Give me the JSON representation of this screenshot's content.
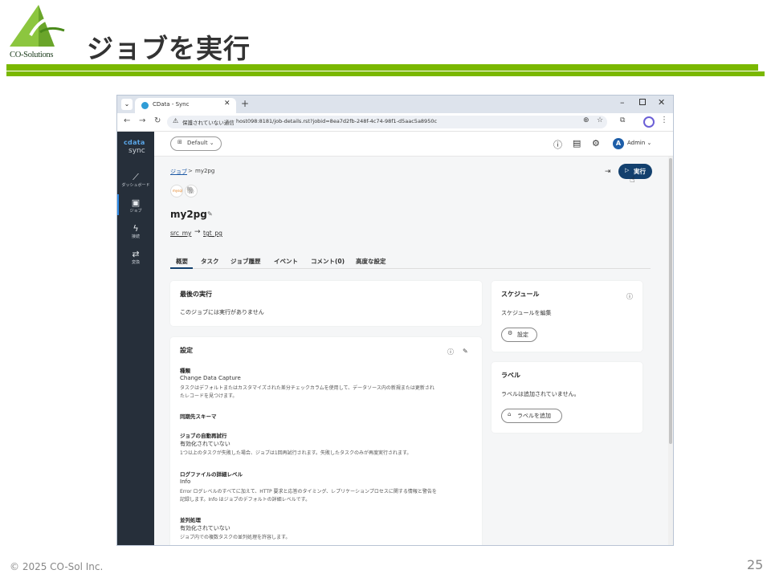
{
  "slide": {
    "logo_text": "CO-Solutions",
    "title": "ジョブを実行",
    "footer": "© 2025 CO-Sol Inc.",
    "page_number": "25",
    "accent_color": "#7ab800"
  },
  "browser": {
    "tab_title": "CData - Sync",
    "tab_close": "✕",
    "new_tab": "+",
    "insecure_label": "保護されていない通信",
    "url": "host098:8181/job-details.rst?jobid=8ea7d2fb-248f-4c74-98f1-d5aac5a8950c"
  },
  "app": {
    "brand_line1": "cdata",
    "brand_line2": "sync",
    "sidebar": [
      {
        "icon": "chart-icon",
        "glyph": "📈",
        "label": "ダッシュボード"
      },
      {
        "icon": "briefcase-icon",
        "glyph": "💼",
        "label": "ジョブ"
      },
      {
        "icon": "bolt-icon",
        "glyph": "ϟ",
        "label": "接続"
      },
      {
        "icon": "transform-icon",
        "glyph": "⇄",
        "label": "変換"
      }
    ],
    "workspace": "Default",
    "user_initial": "A",
    "user_name": "Admin",
    "breadcrumb_root": "ジョブ",
    "breadcrumb_sep": ">",
    "breadcrumb_current": "my2pg",
    "run_label": "実行",
    "job_name": "my2pg",
    "source": "src_my",
    "target": "tgt_pg",
    "arrow": "→",
    "tabs": [
      "概要",
      "タスク",
      "ジョブ履歴",
      "イベント",
      "コメント(0)",
      "高度な設定"
    ],
    "last_run": {
      "title": "最後の実行",
      "text": "このジョブには実行がありません"
    },
    "settings": {
      "title": "設定",
      "type_label": "種類",
      "type_value": "Change Data Capture",
      "type_desc1": "タスクはデフォルトまたはカスタマイズされた差分チェックカラムを使用して、データソース内の新規または更新され",
      "type_desc2": "たレコードを見つけます。",
      "schema_label": "同期先スキーマ",
      "retry_label": "ジョブの自動再試行",
      "retry_value": "有効化されていない",
      "retry_desc": "1つ以上のタスクが失敗した場合、ジョブは1回再試行されます。失敗したタスクのみが再度実行されます。",
      "log_label": "ログファイルの詳細レベル",
      "log_value": "Info",
      "log_desc1": "Error ログレベルのすべてに加えて、HTTP 要求と応答のタイミング、レプリケーションプロセスに関する情報と警告を",
      "log_desc2": "記録します。Info はジョブのデフォルトの詳細レベルです。",
      "parallel_label": "並列処理",
      "parallel_value": "有効化されていない",
      "parallel_desc": "ジョブ内での複数タスクの並列処理を許容します。"
    },
    "schedule": {
      "title": "スケジュール",
      "text": "スケジュールを編集",
      "button": "設定"
    },
    "labels": {
      "title": "ラベル",
      "text": "ラベルは追加されていません。",
      "button": "ラベルを追加"
    }
  }
}
